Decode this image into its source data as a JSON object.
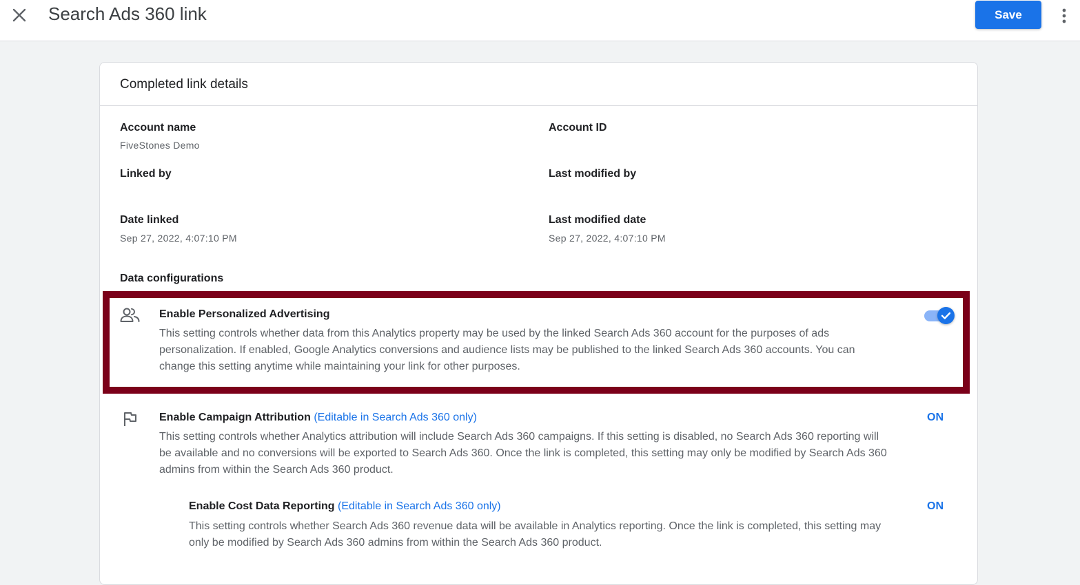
{
  "header": {
    "title": "Search Ads 360 link",
    "save_label": "Save"
  },
  "card": {
    "title": "Completed link details",
    "fields": {
      "account_name": {
        "label": "Account name",
        "value": "FiveStones Demo"
      },
      "account_id": {
        "label": "Account ID",
        "value": ""
      },
      "linked_by": {
        "label": "Linked by",
        "value": ""
      },
      "last_modified_by": {
        "label": "Last modified by",
        "value": ""
      },
      "date_linked": {
        "label": "Date linked",
        "value": "Sep 27, 2022, 4:07:10 PM"
      },
      "last_modified_date": {
        "label": "Last modified date",
        "value": "Sep 27, 2022, 4:07:10 PM"
      }
    },
    "data_config_label": "Data configurations",
    "settings": [
      {
        "icon": "people-icon",
        "title": "Enable Personalized Advertising",
        "editable_note": "",
        "description": "This setting controls whether data from this Analytics property may be used by the linked Search Ads 360 account for the purposes of ads personalization. If enabled, Google Analytics conversions and audience lists may be published to the linked Search Ads 360 accounts. You can change this setting anytime while maintaining your link for other purposes.",
        "toggle_on": true
      },
      {
        "icon": "flag-icon",
        "title": "Enable Campaign Attribution",
        "editable_note": "(Editable in Search Ads 360 only)",
        "description": "This setting controls whether Analytics attribution will include Search Ads 360 campaigns. If this setting is disabled, no Search Ads 360 reporting will be available and no conversions will be exported to Search Ads 360. Once the link is completed, this setting may only be modified by Search Ads 360 admins from within the Search Ads 360 product.",
        "status": "ON"
      },
      {
        "title": "Enable Cost Data Reporting",
        "editable_note": "(Editable in Search Ads 360 only)",
        "description": "This setting controls whether Search Ads 360 revenue data will be available in Analytics reporting. Once the link is completed, this setting may only be modified by Search Ads 360 admins from within the Search Ads 360 product.",
        "status": "ON"
      }
    ]
  },
  "colors": {
    "accent": "#1a73e8",
    "highlight_border": "#7b0019",
    "toggle_track": "#8ab4f8"
  }
}
